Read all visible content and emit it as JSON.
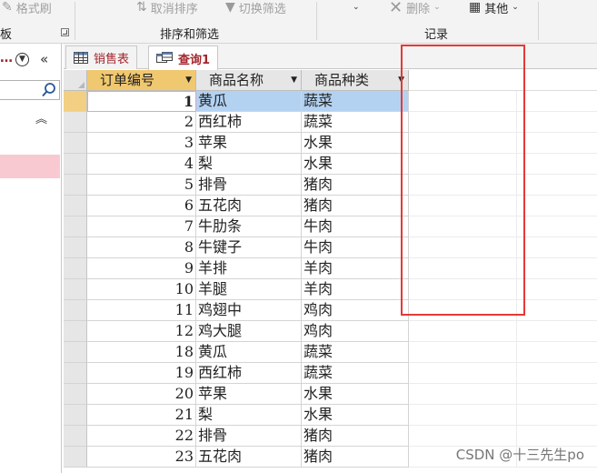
{
  "ribbon": {
    "format_painter": "格式刷",
    "remove_sort": "取消排序",
    "toggle_filter": "切换筛选",
    "delete": "删除",
    "more": "其他",
    "group_clipboard": "板",
    "group_sort_filter": "排序和筛选",
    "group_records": "记录"
  },
  "nav": {
    "title_dots": "…"
  },
  "tabs": [
    {
      "label": "销售表",
      "active": false
    },
    {
      "label": "查询1",
      "active": true
    }
  ],
  "table": {
    "headers": [
      "订单编号",
      "商品名称",
      "商品种类"
    ],
    "rows": [
      {
        "id": "1",
        "name": "黄瓜",
        "kind": "蔬菜"
      },
      {
        "id": "2",
        "name": "西红柿",
        "kind": "蔬菜"
      },
      {
        "id": "3",
        "name": "苹果",
        "kind": "水果"
      },
      {
        "id": "4",
        "name": "梨",
        "kind": "水果"
      },
      {
        "id": "5",
        "name": "排骨",
        "kind": "猪肉"
      },
      {
        "id": "6",
        "name": "五花肉",
        "kind": "猪肉"
      },
      {
        "id": "7",
        "name": "牛肋条",
        "kind": "牛肉"
      },
      {
        "id": "8",
        "name": "牛键子",
        "kind": "牛肉"
      },
      {
        "id": "9",
        "name": "羊排",
        "kind": "羊肉"
      },
      {
        "id": "10",
        "name": "羊腿",
        "kind": "羊肉"
      },
      {
        "id": "11",
        "name": "鸡翅中",
        "kind": "鸡肉"
      },
      {
        "id": "12",
        "name": "鸡大腿",
        "kind": "鸡肉"
      },
      {
        "id": "18",
        "name": "黄瓜",
        "kind": "蔬菜"
      },
      {
        "id": "19",
        "name": "西红柿",
        "kind": "蔬菜"
      },
      {
        "id": "20",
        "name": "苹果",
        "kind": "水果"
      },
      {
        "id": "21",
        "name": "梨",
        "kind": "水果"
      },
      {
        "id": "22",
        "name": "排骨",
        "kind": "猪肉"
      },
      {
        "id": "23",
        "name": "五花肉",
        "kind": "猪肉"
      }
    ]
  },
  "watermark": "CSDN @十三先生po",
  "colors": {
    "accent": "#a4262c",
    "annotation": "#e53935",
    "selection": "#b3d2f2",
    "record_indicator": "#f2cf82"
  }
}
